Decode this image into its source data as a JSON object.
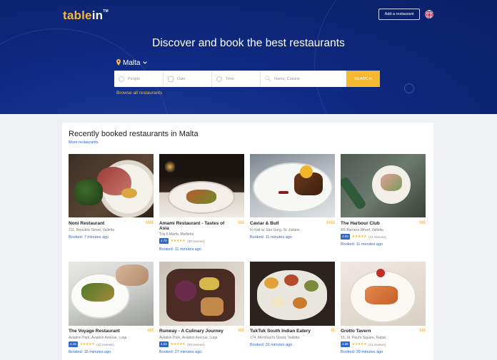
{
  "header": {
    "logo_main": "table",
    "logo_accent": "in",
    "logo_tm": "TM",
    "add_restaurant_label": "Add a restaurant",
    "language_flag_icon": "uk-flag-icon"
  },
  "hero": {
    "headline": "Discover and book the best restaurants",
    "location": "Malta",
    "browse_link": "Browse all restaurants"
  },
  "search": {
    "people_placeholder": "People",
    "date_placeholder": "Date",
    "time_placeholder": "Time",
    "query_placeholder": "Name, Cuisine",
    "button_label": "SEARCH"
  },
  "section": {
    "title": "Recently booked restaurants in Malta",
    "more_link": "More restaurants"
  },
  "restaurants": [
    {
      "name": "Noni Restaurant",
      "price": "€€€€",
      "address": "211, Republic Street, Valletta",
      "score": "",
      "reviews": "",
      "booked": "Booked: 7 minutes ago"
    },
    {
      "name": "Amami Restaurant - Tastes of Asia",
      "price": "€€€",
      "address": "Triq Il-Marfa, Mellieha",
      "score": "4.78",
      "reviews": "(29 reviews)",
      "booked": "Booked: 11 minutes ago"
    },
    {
      "name": "Caviar & Bull",
      "price": "€€€€",
      "address": "Ix-Xatt ta' San Gorg, St. Julians",
      "score": "",
      "reviews": "",
      "booked": "Booked: 11 minutes ago"
    },
    {
      "name": "The Harbour Club",
      "price": "€€€",
      "address": "4/5 Barriera Wharf, Valletta",
      "score": "4.63",
      "reviews": "(21 reviews)",
      "booked": "Booked: 11 minutes ago"
    },
    {
      "name": "The Voyage Restaurant",
      "price": "€€€",
      "address": "Aviation Park, Aviation Avenue, Luqa",
      "score": "4.48",
      "reviews": "(42 reviews)",
      "booked": "Booked: 15 minutes ago"
    },
    {
      "name": "Runway - A Culinary Journey",
      "price": "€€€",
      "address": "Aviation Park, Aviation Avenue, Luqa",
      "score": "4.24",
      "reviews": "(59 reviews)",
      "booked": "Booked: 17 minutes ago"
    },
    {
      "name": "TukTuk South Indian Eatery",
      "price": "€€",
      "address": "174, Merchant's Street, Valletta",
      "score": "",
      "reviews": "",
      "booked": "Booked: 31 minutes ago"
    },
    {
      "name": "Grotto Tavern",
      "price": "€€€",
      "address": "10, St. Paul's Square, Rabat",
      "score": "4.66",
      "reviews": "(11 reviews)",
      "booked": "Booked: 39 minutes ago"
    }
  ],
  "colors": {
    "hero_bg": "#0f2a82",
    "accent_gold": "#f6b830",
    "link_blue": "#2f68c9"
  }
}
